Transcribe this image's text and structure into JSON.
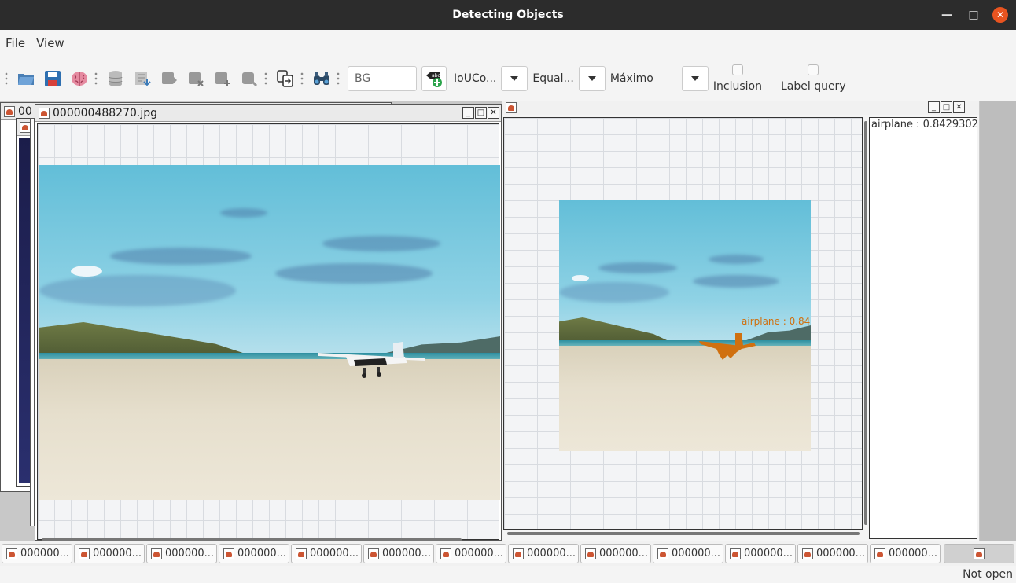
{
  "window": {
    "title": "Detecting Objects"
  },
  "menu": {
    "file": "File",
    "view": "View"
  },
  "toolbar": {
    "text_field_value": "BG",
    "combo1_label": "IoUCo...",
    "combo2_label": "Equal...",
    "combo3_label": "Máximo",
    "check_inclusion": "Inclusion",
    "check_label_query": "Label query",
    "icons": [
      "folder-open-icon",
      "save-icon",
      "brain-icon",
      "database-icon",
      "database-import-icon",
      "tag-add-icon",
      "tag-remove-icon",
      "tag-plus-icon",
      "tag-comment-icon",
      "copy-arrow-icon",
      "binoculars-icon",
      "label-abc-add-icon"
    ]
  },
  "left_window": {
    "title": "000000488270.jpg",
    "back_title_fragment": "00"
  },
  "result_window": {
    "detection_list": [
      "airplane : 0.8429302"
    ],
    "overlay_label": "airplane : 0.84",
    "mask_color": "#d0700f"
  },
  "taskbar": {
    "items": [
      "000000...",
      "000000...",
      "000000...",
      "000000...",
      "000000...",
      "000000...",
      "000000...",
      "000000...",
      "000000...",
      "000000...",
      "000000...",
      "000000...",
      "000000..."
    ]
  },
  "status": {
    "text": "Not open"
  },
  "colors": {
    "titlebar": "#2c2c2c",
    "close_button": "#e95420",
    "accent_orange": "#d0700f"
  }
}
